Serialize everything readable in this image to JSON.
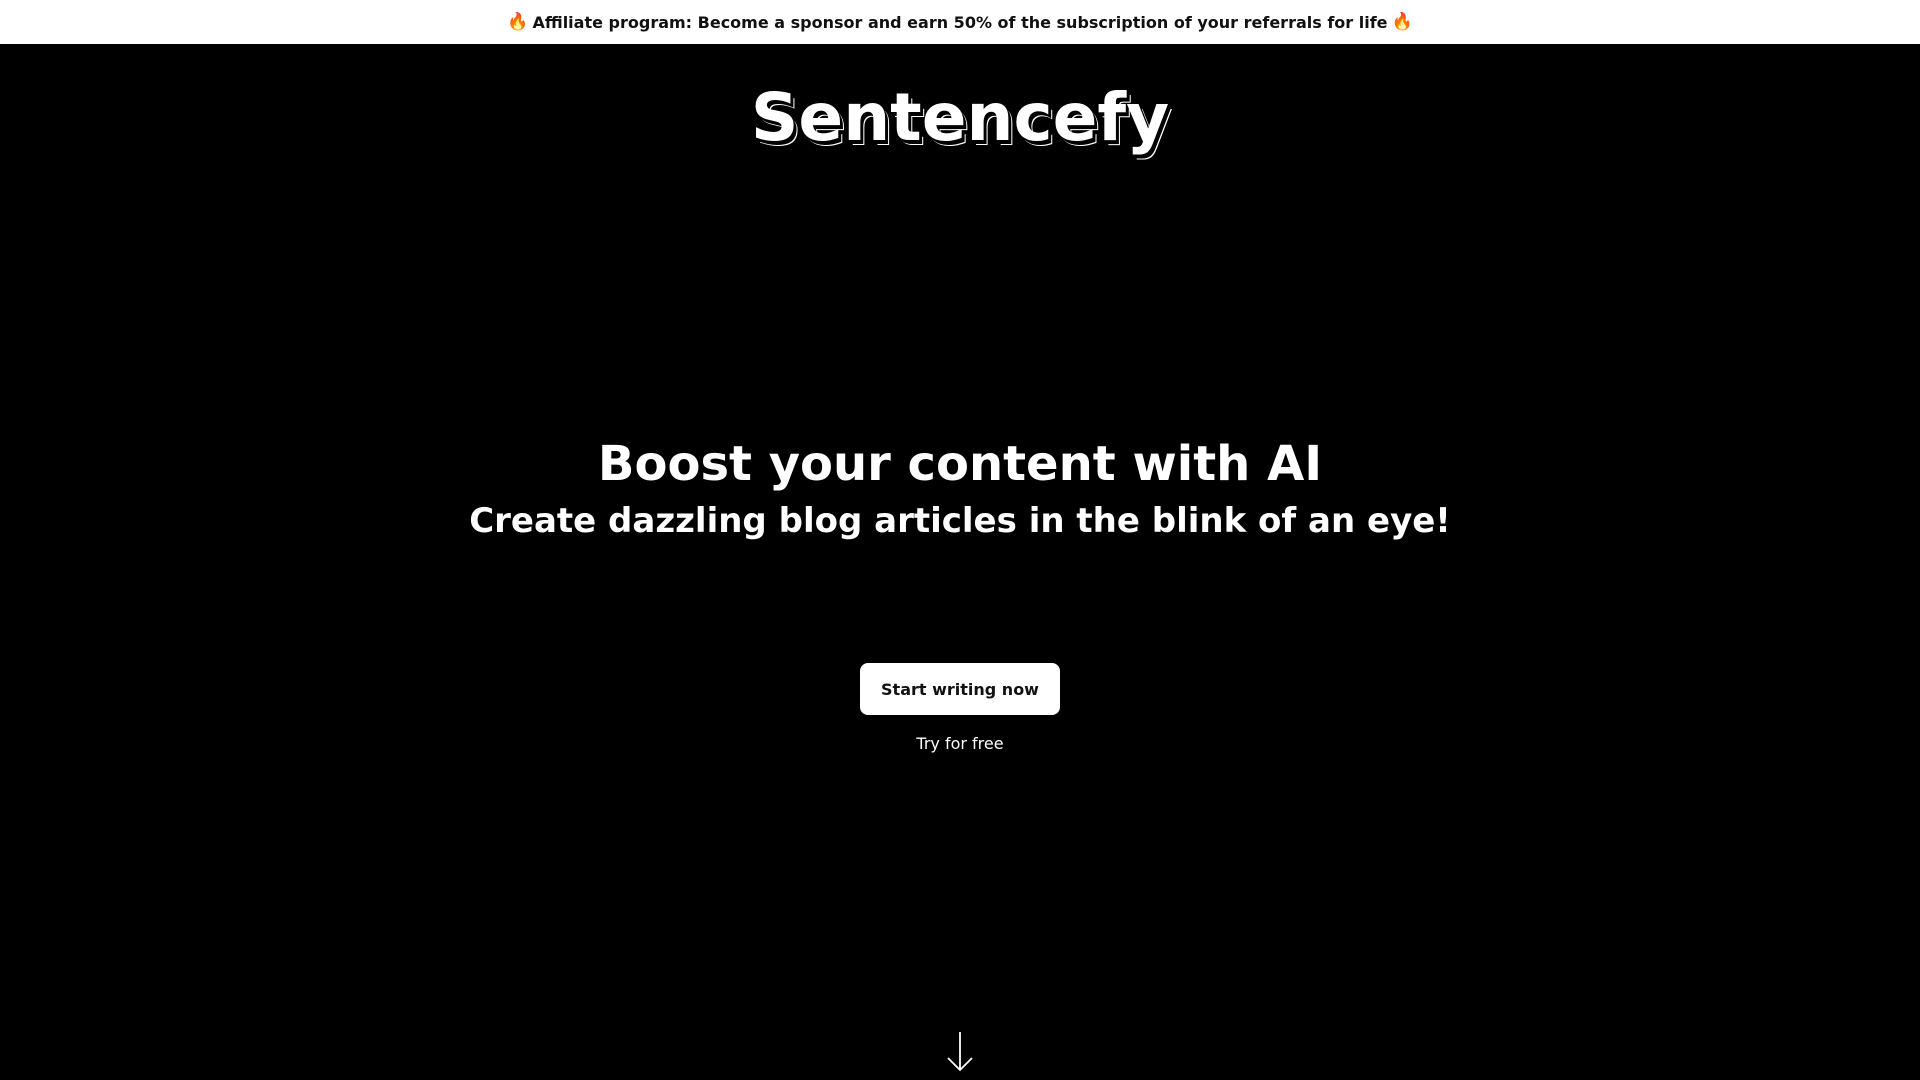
{
  "banner": {
    "icon_left": "fire-icon",
    "icon_right": "fire-icon",
    "emoji": "🔥",
    "text": "Affiliate program: Become a sponsor and earn 50% of the subscription of your referrals for life"
  },
  "logo": {
    "text": "Sentencefy"
  },
  "hero": {
    "headline": "Boost your content with AI",
    "subheadline": "Create dazzling blog articles in the blink of an eye!"
  },
  "cta": {
    "label": "Start writing now",
    "note": "Try for free"
  },
  "scroll": {
    "icon": "arrow-down-icon"
  },
  "colors": {
    "background": "#000000",
    "text": "#ffffff",
    "banner_background": "#ffffff",
    "banner_text": "#111111"
  }
}
